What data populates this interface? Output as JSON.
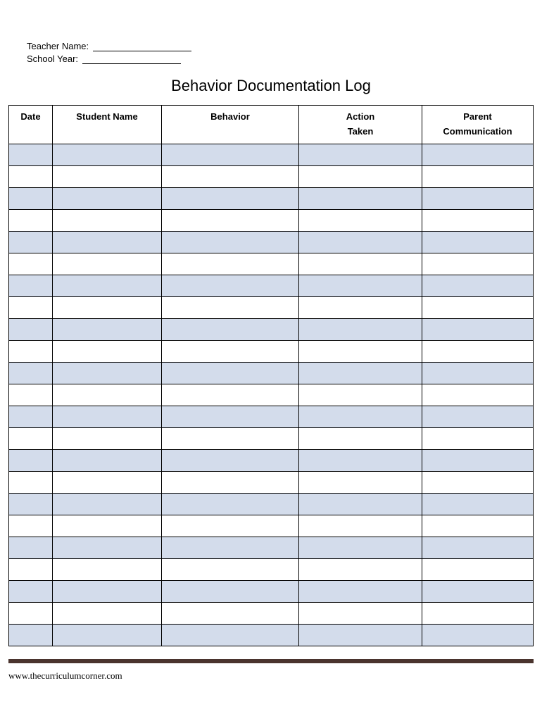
{
  "header": {
    "teacher_label": "Teacher Name:",
    "school_year_label": "School Year:"
  },
  "title": "Behavior Documentation Log",
  "columns": {
    "date": "Date",
    "student": "Student Name",
    "behavior": "Behavior",
    "action_line1": "Action",
    "action_line2": "Taken",
    "parent_line1": "Parent",
    "parent_line2": "Communication"
  },
  "row_count": 23,
  "footer_url": "www.thecurriculumcorner.com"
}
